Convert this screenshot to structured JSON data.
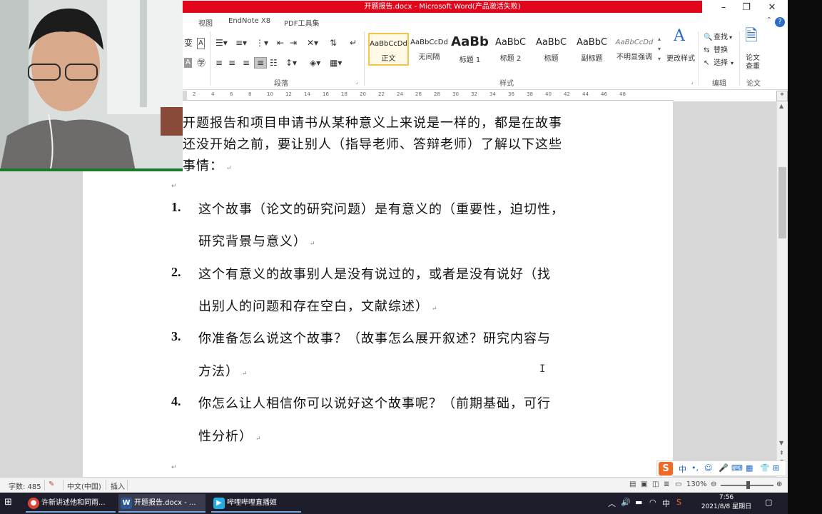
{
  "window": {
    "title": "开题报告.docx - Microsoft Word(产品激活失败)",
    "minimize": "–",
    "restore": "❐",
    "close": "✕"
  },
  "menu": {
    "items": [
      "视图",
      "EndNote X8",
      "PDF工具集"
    ],
    "help": "?"
  },
  "ribbon": {
    "groups": {
      "paragraph": "段落",
      "styles": "样式",
      "editing": "编辑",
      "thesis": "论文"
    },
    "styles": [
      {
        "sample": "AaBbCcDd",
        "name": "正文"
      },
      {
        "sample": "AaBbCcDd",
        "name": "无间隔"
      },
      {
        "sample": "AaBb",
        "name": "标题 1"
      },
      {
        "sample": "AaBbC",
        "name": "标题 2"
      },
      {
        "sample": "AaBbC",
        "name": "标题"
      },
      {
        "sample": "AaBbC",
        "name": "副标题"
      },
      {
        "sample": "AaBbCcDd",
        "name": "不明显强调"
      }
    ],
    "change_styles": "更改样式",
    "find": "查找",
    "replace": "替换",
    "select": "选择",
    "check": "论文查重"
  },
  "ruler": {
    "ticks": [
      "2",
      "4",
      "6",
      "8",
      "10",
      "12",
      "14",
      "16",
      "18",
      "20",
      "22",
      "24",
      "26",
      "28",
      "30",
      "32",
      "34",
      "36",
      "38",
      "40",
      "42",
      "44",
      "46",
      "48"
    ]
  },
  "document": {
    "intro": [
      "开题报告和项目申请书从某种意义上来说是一样的，都是在故事",
      "还没开始之前，要让别人（指导老师、答辩老师）了解以下这些",
      "事情："
    ],
    "items": [
      {
        "num": "1.",
        "line1": "这个故事（论文的研究问题）是有意义的（重要性，迫切性，",
        "line2": "研究背景与意义）"
      },
      {
        "num": "2.",
        "line1": "这个有意义的故事别人是没有说过的，或者是没有说好（找",
        "line2": "出别人的问题和存在空白，文献综述）"
      },
      {
        "num": "3.",
        "line1": "你准备怎么说这个故事？（故事怎么展开叙述？研究内容与",
        "line2": "方法）"
      },
      {
        "num": "4.",
        "line1": "你怎么让人相信你可以说好这个故事呢？（前期基础，可行",
        "line2": "性分析）"
      }
    ],
    "para_mark": "↵"
  },
  "status": {
    "word_count": "字数: 485",
    "language": "中文(中国)",
    "mode": "插入",
    "zoom": "130%"
  },
  "ime": {
    "logo": "S",
    "lang": "中"
  },
  "taskbar": {
    "items": [
      {
        "label": "许新讲述他和同雨...",
        "icon": "chrome-icon"
      },
      {
        "label": "开题报告.docx - ...",
        "icon": "word-icon"
      },
      {
        "label": "哔哩哔哩直播姬",
        "icon": "bilibili-icon"
      }
    ],
    "tray_lang": "中",
    "time": "7:56",
    "date": "2021/8/8 星期日"
  },
  "colors": {
    "title_red": "#e2061a",
    "accent": "#2b6cc4",
    "taskbar": "#1d1d2c"
  }
}
